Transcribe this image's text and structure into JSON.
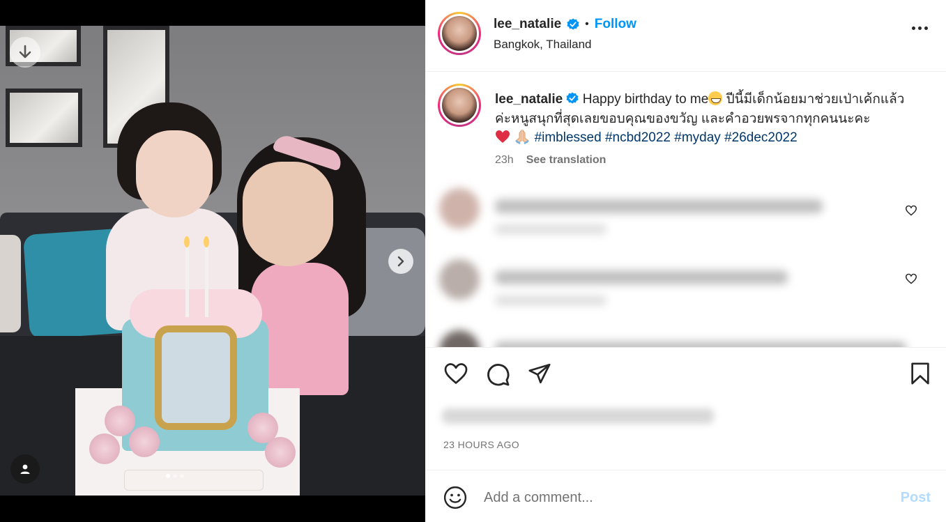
{
  "post": {
    "author": "lee_natalie",
    "verified": true,
    "follow_label": "Follow",
    "bullet": "•",
    "location": "Bangkok, Thailand"
  },
  "caption": {
    "username": "lee_natalie",
    "text_start": "Happy birthday to me",
    "text_thai": " ปีนี้มีเด็กน้อยมาช่วยเป่าเค้กแล้วค่ะหนูสนุกที่สุดเลยขอบคุณของขวัญ และคำอวยพรจากทุกคนนะคะ",
    "hashtags": [
      "#imblessed",
      "#ncbd2022",
      "#myday",
      "#26dec2022"
    ],
    "time": "23h",
    "see_translation": "See translation"
  },
  "meta": {
    "time_ago": "23 HOURS AGO"
  },
  "composer": {
    "placeholder": "Add a comment...",
    "post_label": "Post"
  },
  "carousel": {
    "slide_count": 3,
    "active_index": 0
  },
  "colors": {
    "accent": "#0095f6",
    "hashtag": "#00376b",
    "muted": "#737373",
    "post_disabled": "#b3dbff"
  }
}
